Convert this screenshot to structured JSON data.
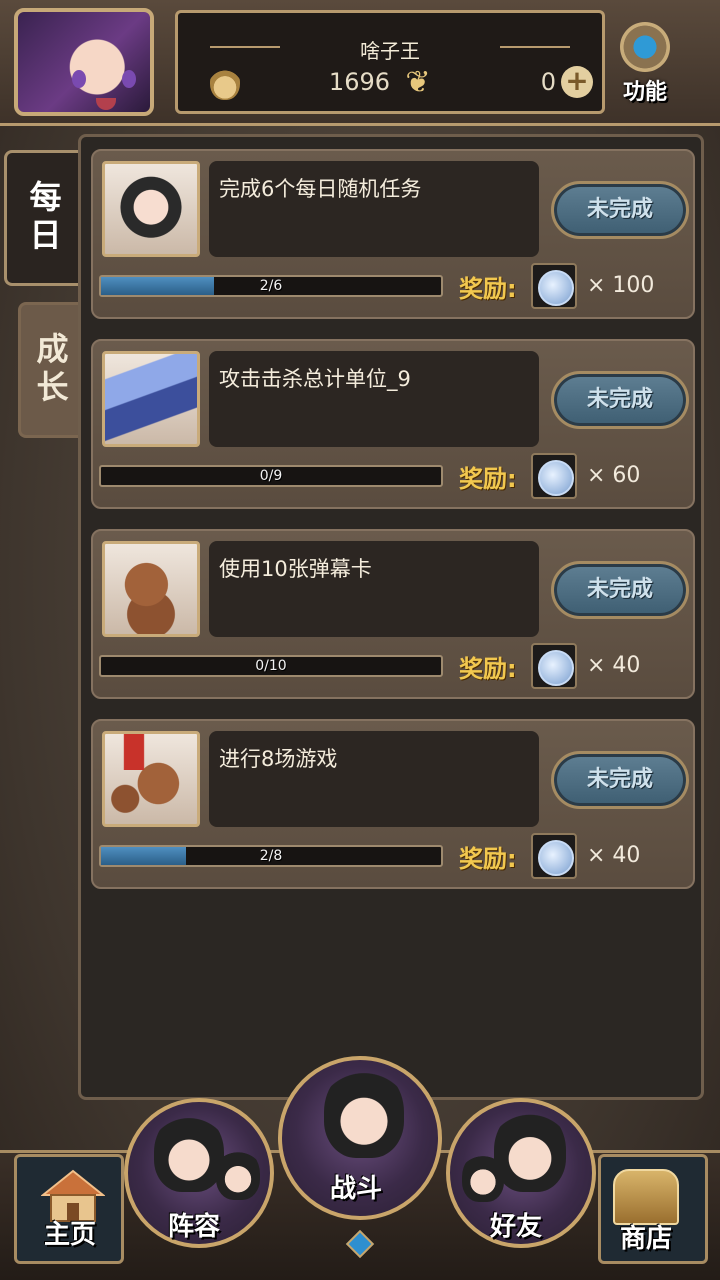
{
  "header": {
    "player_name": "啥子王",
    "currency_1": "1696",
    "currency_2": "0",
    "function_label": "功能"
  },
  "tabs": [
    {
      "label": "每日"
    },
    {
      "label": "成长"
    }
  ],
  "quests": [
    {
      "title": "完成6个每日随机任务",
      "status": "未完成",
      "progress_text": "2/6",
      "progress": 0.333,
      "reward_label": "奖励:",
      "reward_qty": "× 100"
    },
    {
      "title": "攻击击杀总计单位_9",
      "status": "未完成",
      "progress_text": "0/9",
      "progress": 0.0,
      "reward_label": "奖励:",
      "reward_qty": "× 60"
    },
    {
      "title": "使用10张弹幕卡",
      "status": "未完成",
      "progress_text": "0/10",
      "progress": 0.0,
      "reward_label": "奖励:",
      "reward_qty": "× 40"
    },
    {
      "title": "进行8场游戏",
      "status": "未完成",
      "progress_text": "2/8",
      "progress": 0.25,
      "reward_label": "奖励:",
      "reward_qty": "× 40"
    }
  ],
  "nav": {
    "home": "主页",
    "lineup": "阵容",
    "battle": "战斗",
    "friends": "好友",
    "shop": "商店"
  }
}
